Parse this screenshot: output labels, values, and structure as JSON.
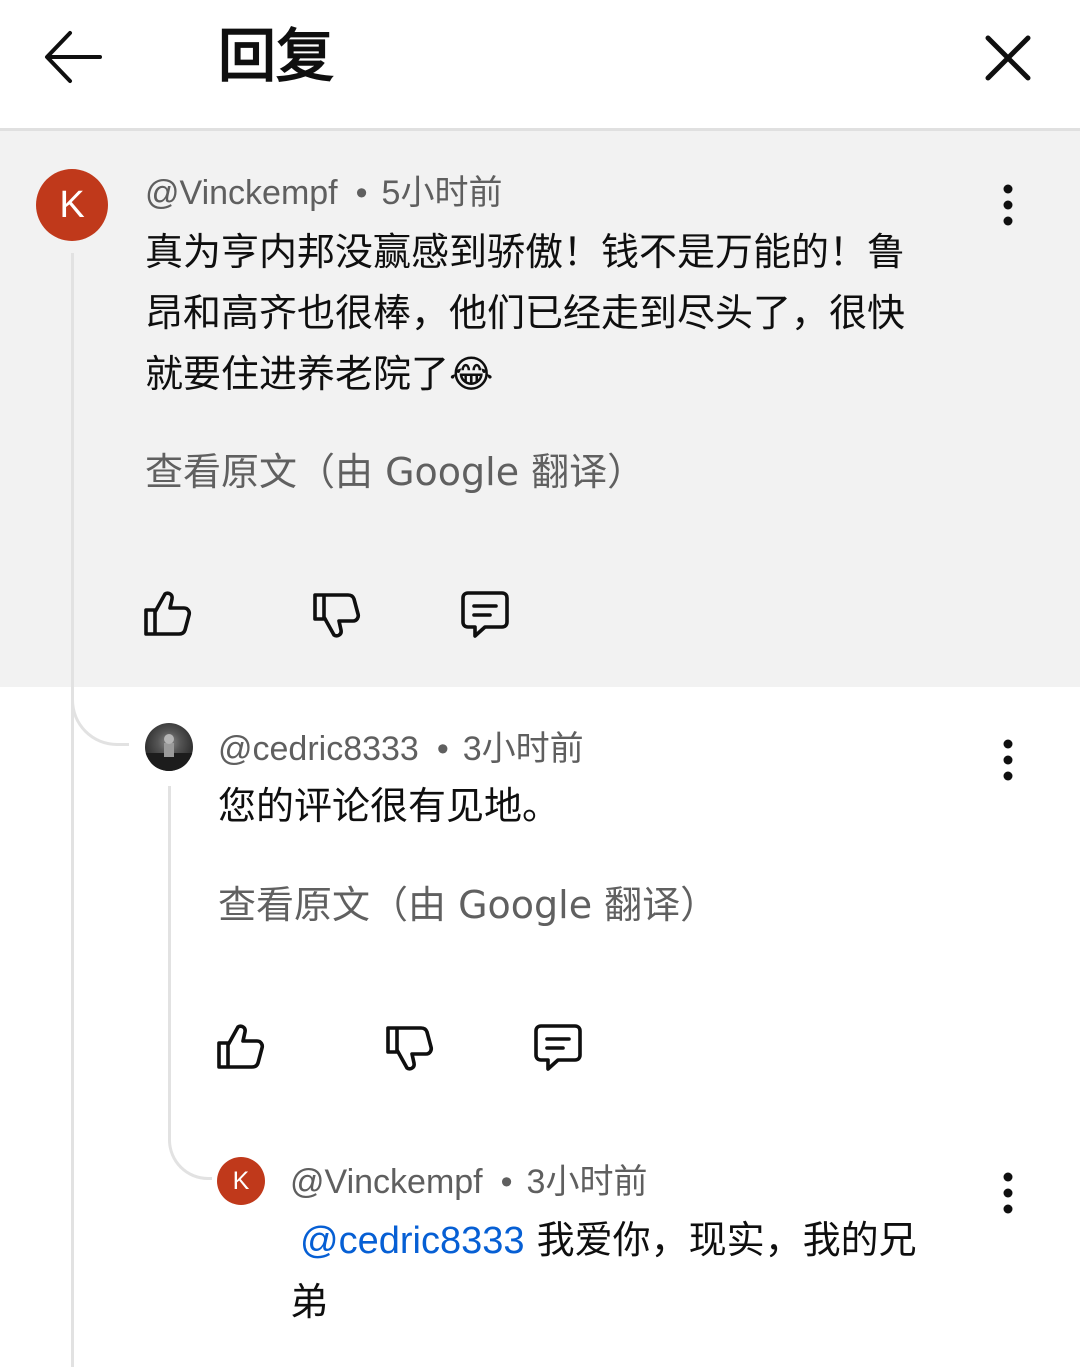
{
  "header": {
    "title": "回复",
    "back_icon": "arrow-left-icon",
    "close_icon": "close-icon"
  },
  "colors": {
    "parent_bg": "#f2f2f2",
    "avatar_k": "#c0391b",
    "mention": "#065fd4",
    "meta_text": "#5f5f5f"
  },
  "comments": [
    {
      "avatar_letter": "K",
      "author": "@Vinckempf",
      "separator": "•",
      "time": "5小时前",
      "text_lines": [
        "真为亨内邦没赢感到骄傲！钱不是万能的！鲁",
        "昂和高齐也很棒，他们已经走到尽头了，很快",
        "就要住进养老院了😂"
      ],
      "translate_label": "查看原文（由 Google 翻译）"
    },
    {
      "author": "@cedric8333",
      "separator": "•",
      "time": "3小时前",
      "text": "您的评论很有见地。",
      "translate_label": "查看原文（由 Google 翻译）"
    },
    {
      "avatar_letter": "K",
      "author": "@Vinckempf",
      "separator": "•",
      "time": "3小时前",
      "mention": "@cedric8333",
      "text_line1": " 我爱你，现实，我的兄",
      "text_line2": "弟"
    }
  ]
}
